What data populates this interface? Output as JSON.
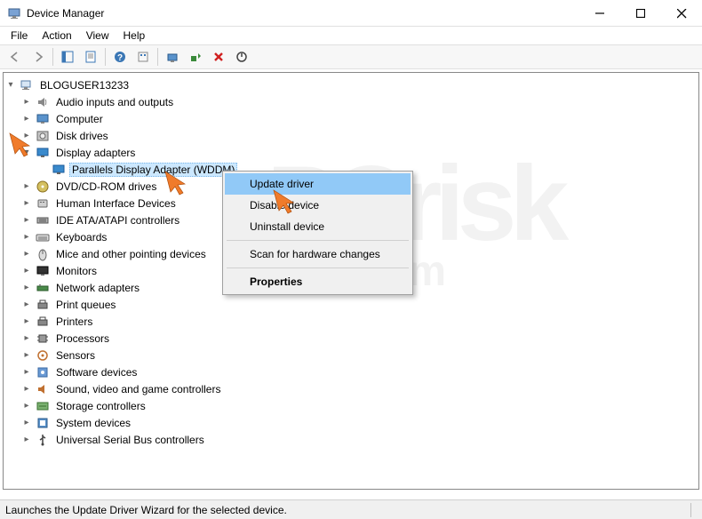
{
  "title": "Device Manager",
  "menu": {
    "file": "File",
    "action": "Action",
    "view": "View",
    "help": "Help"
  },
  "root": "BLOGUSER13233",
  "categories": [
    {
      "label": "Audio inputs and outputs",
      "icon": "speaker"
    },
    {
      "label": "Computer",
      "icon": "monitor"
    },
    {
      "label": "Disk drives",
      "icon": "disk"
    },
    {
      "label": "Display adapters",
      "icon": "display",
      "expanded": true,
      "children": [
        {
          "label": "Parallels Display Adapter (WDDM)",
          "icon": "display",
          "selected": true
        }
      ]
    },
    {
      "label": "DVD/CD-ROM drives",
      "icon": "dvd"
    },
    {
      "label": "Human Interface Devices",
      "icon": "hid"
    },
    {
      "label": "IDE ATA/ATAPI controllers",
      "icon": "ide"
    },
    {
      "label": "Keyboards",
      "icon": "keyboard"
    },
    {
      "label": "Mice and other pointing devices",
      "icon": "mouse"
    },
    {
      "label": "Monitors",
      "icon": "monitor2"
    },
    {
      "label": "Network adapters",
      "icon": "net"
    },
    {
      "label": "Print queues",
      "icon": "print"
    },
    {
      "label": "Printers",
      "icon": "print"
    },
    {
      "label": "Processors",
      "icon": "cpu"
    },
    {
      "label": "Sensors",
      "icon": "sensor"
    },
    {
      "label": "Software devices",
      "icon": "soft"
    },
    {
      "label": "Sound, video and game controllers",
      "icon": "sound"
    },
    {
      "label": "Storage controllers",
      "icon": "storage"
    },
    {
      "label": "System devices",
      "icon": "sys"
    },
    {
      "label": "Universal Serial Bus controllers",
      "icon": "usb"
    }
  ],
  "context_menu": {
    "items": [
      {
        "label": "Update driver",
        "highlight": true
      },
      {
        "label": "Disable device"
      },
      {
        "label": "Uninstall device"
      },
      {
        "sep": true
      },
      {
        "label": "Scan for hardware changes"
      },
      {
        "sep": true
      },
      {
        "label": "Properties",
        "bold": true
      }
    ]
  },
  "status": "Launches the Update Driver Wizard for the selected device.",
  "watermark": {
    "big": "PCrisk",
    "small": ".com"
  }
}
